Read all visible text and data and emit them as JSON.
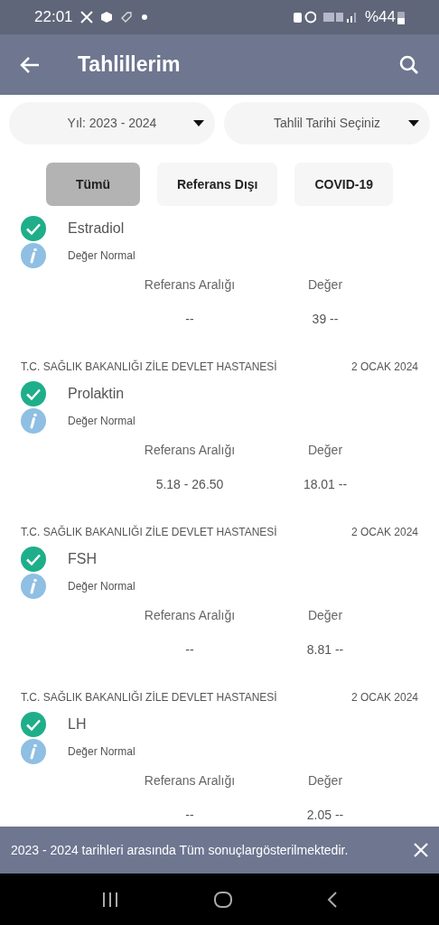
{
  "status_bar": {
    "time": "22:01",
    "battery": "%44"
  },
  "app_bar": {
    "title": "Tahlillerim"
  },
  "filters": [
    {
      "label": "Yıl: 2023 - 2024"
    },
    {
      "label": "Tahlil Tarihi Seçiniz"
    }
  ],
  "tabs": [
    {
      "label": "Tümü",
      "selected": true
    },
    {
      "label": "Referans Dışı",
      "selected": false
    },
    {
      "label": "COVID-19",
      "selected": false
    }
  ],
  "results": [
    {
      "name": "Estradiol",
      "status": "Değer Normal",
      "normal": true,
      "range_label": "Referans Aralığı",
      "value_label": "Değer",
      "range": "--",
      "value": "39 --"
    },
    {
      "hospital": "T.C. SAĞLIK BAKANLIĞI ZİLE DEVLET HASTANESİ",
      "date": "2 OCAK 2024",
      "name": "Prolaktin",
      "status": "Değer Normal",
      "normal": true,
      "range_label": "Referans Aralığı",
      "value_label": "Değer",
      "range": "5.18 - 26.50",
      "value": "18.01 --"
    },
    {
      "hospital": "T.C. SAĞLIK BAKANLIĞI ZİLE DEVLET HASTANESİ",
      "date": "2 OCAK 2024",
      "name": "FSH",
      "status": "Değer Normal",
      "normal": true,
      "range_label": "Referans Aralığı",
      "value_label": "Değer",
      "range": "--",
      "value": "8.81 --"
    },
    {
      "hospital": "T.C. SAĞLIK BAKANLIĞI ZİLE DEVLET HASTANESİ",
      "date": "2 OCAK 2024",
      "name": "LH",
      "status": "Değer Normal",
      "normal": true,
      "range_label": "Referans Aralığı",
      "value_label": "Değer",
      "range": "--",
      "value": "2.05 --"
    }
  ],
  "snackbar": {
    "message": "2023 - 2024 tarihleri arasında Tüm sonuçlargösterilmektedir."
  }
}
